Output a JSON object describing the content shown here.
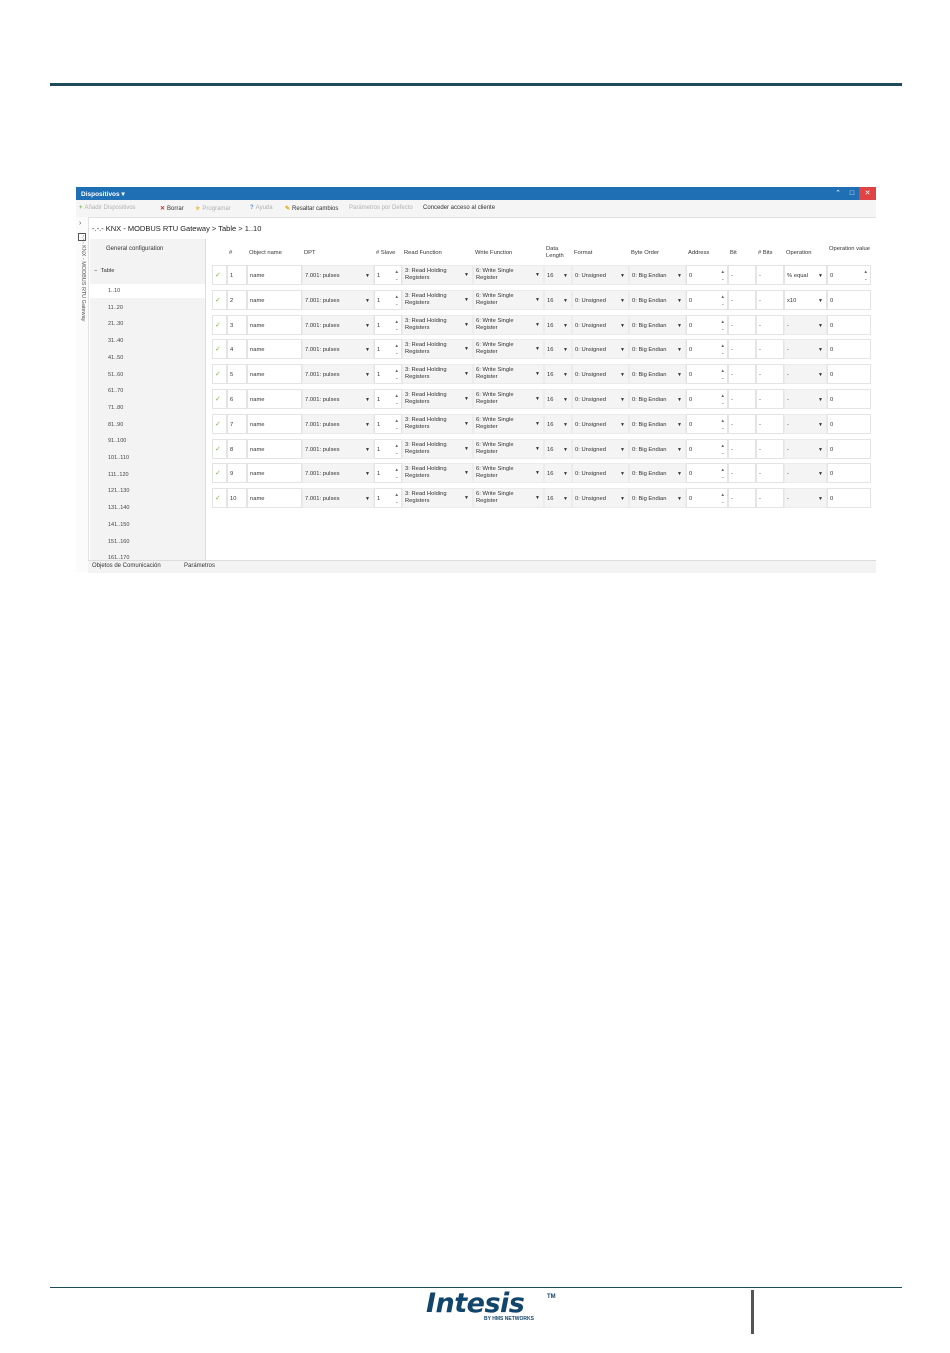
{
  "app": {
    "title": "Dispositivos ▾",
    "window_buttons": [
      "⌃",
      "□",
      "✕"
    ],
    "toolbar": [
      {
        "label": "Añadir Dispositivos",
        "icon": "+",
        "dim": true
      },
      {
        "label": "Borrar",
        "icon": "✕",
        "dim": false
      },
      {
        "label": "Programar",
        "icon": "★",
        "dim": true
      },
      {
        "label": "Ayuda",
        "icon": "?",
        "dim": true
      },
      {
        "label": "Resaltar cambios",
        "icon": "✎",
        "dim": false
      },
      {
        "label": "Parámetros por Defecto",
        "icon": "",
        "dim": true
      },
      {
        "label": "Conceder acceso al cliente",
        "icon": "",
        "dim": false
      }
    ],
    "side_strip_label": "-.-.- KNX - MODBUS RTU Gateway",
    "breadcrumb": {
      "prefix": "-.-.-",
      "path": "KNX - MODBUS RTU Gateway > Table > 1..10"
    },
    "tree": {
      "general": "General configuration",
      "table": "Table",
      "items": [
        "1..10",
        "11..20",
        "21..30",
        "31..40",
        "41..50",
        "51..60",
        "61..70",
        "71..80",
        "81..90",
        "91..100",
        "101..110",
        "111..120",
        "121..130",
        "131..140",
        "141..150",
        "151..160",
        "161..170"
      ],
      "selected": "1..10"
    },
    "columns": [
      "",
      "#",
      "Object name",
      "DPT",
      "# Slave",
      "Read Function",
      "Write Function",
      "Data Length",
      "Format",
      "Byte Order",
      "Address",
      "Bit",
      "# Bits",
      "Operation",
      "Operation value"
    ],
    "rows": [
      {
        "num": "1",
        "name": "name",
        "dpt": "7.001: pulses",
        "slave": "1",
        "read": "3: Read Holding Registers",
        "write": "6: Write Single Register",
        "length": "16",
        "format": "0: Unsigned",
        "order": "0: Big Endian",
        "address": "0",
        "bit": "-",
        "bits": "-",
        "op": "% equal",
        "opval": "0"
      },
      {
        "num": "2",
        "name": "name",
        "dpt": "7.001: pulses",
        "slave": "1",
        "read": "3: Read Holding Registers",
        "write": "6: Write Single Register",
        "length": "16",
        "format": "0: Unsigned",
        "order": "0: Big Endian",
        "address": "0",
        "bit": "-",
        "bits": "-",
        "op": "x10",
        "opval": "0"
      },
      {
        "num": "3",
        "name": "name",
        "dpt": "7.001: pulses",
        "slave": "1",
        "read": "3: Read Holding Registers",
        "write": "6: Write Single Register",
        "length": "16",
        "format": "0: Unsigned",
        "order": "0: Big Endian",
        "address": "0",
        "bit": "-",
        "bits": "-",
        "op": "-",
        "opval": "0"
      },
      {
        "num": "4",
        "name": "name",
        "dpt": "7.001: pulses",
        "slave": "1",
        "read": "3: Read Holding Registers",
        "write": "6: Write Single Register",
        "length": "16",
        "format": "0: Unsigned",
        "order": "0: Big Endian",
        "address": "0",
        "bit": "-",
        "bits": "-",
        "op": "-",
        "opval": "0"
      },
      {
        "num": "5",
        "name": "name",
        "dpt": "7.001: pulses",
        "slave": "1",
        "read": "3: Read Holding Registers",
        "write": "6: Write Single Register",
        "length": "16",
        "format": "0: Unsigned",
        "order": "0: Big Endian",
        "address": "0",
        "bit": "-",
        "bits": "-",
        "op": "-",
        "opval": "0"
      },
      {
        "num": "6",
        "name": "name",
        "dpt": "7.001: pulses",
        "slave": "1",
        "read": "3: Read Holding Registers",
        "write": "6: Write Single Register",
        "length": "16",
        "format": "0: Unsigned",
        "order": "0: Big Endian",
        "address": "0",
        "bit": "-",
        "bits": "-",
        "op": "-",
        "opval": "0"
      },
      {
        "num": "7",
        "name": "name",
        "dpt": "7.001: pulses",
        "slave": "1",
        "read": "3: Read Holding Registers",
        "write": "6: Write Single Register",
        "length": "16",
        "format": "0: Unsigned",
        "order": "0: Big Endian",
        "address": "0",
        "bit": "-",
        "bits": "-",
        "op": "-",
        "opval": "0"
      },
      {
        "num": "8",
        "name": "name",
        "dpt": "7.001: pulses",
        "slave": "1",
        "read": "3: Read Holding Registers",
        "write": "6: Write Single Register",
        "length": "16",
        "format": "0: Unsigned",
        "order": "0: Big Endian",
        "address": "0",
        "bit": "-",
        "bits": "-",
        "op": "-",
        "opval": "0"
      },
      {
        "num": "9",
        "name": "name",
        "dpt": "7.001: pulses",
        "slave": "1",
        "read": "3: Read Holding Registers",
        "write": "6: Write Single Register",
        "length": "16",
        "format": "0: Unsigned",
        "order": "0: Big Endian",
        "address": "0",
        "bit": "-",
        "bits": "-",
        "op": "-",
        "opval": "0"
      },
      {
        "num": "10",
        "name": "name",
        "dpt": "7.001: pulses",
        "slave": "1",
        "read": "3: Read Holding Registers",
        "write": "6: Write Single Register",
        "length": "16",
        "format": "0: Unsigned",
        "order": "0: Big Endian",
        "address": "0",
        "bit": "-",
        "bits": "-",
        "op": "-",
        "opval": "0"
      }
    ],
    "tabs": [
      "Objetos de Comunicación",
      "Parámetros"
    ]
  },
  "footer": {
    "logo": "Intesis",
    "logo_tm": "TM",
    "logo_sub": "BY HMS NETWORKS"
  },
  "colors": {
    "rule": "#1e4a5c",
    "titlebar": "#1f6fb5",
    "logo": "#12456b",
    "check": "#7fb34b"
  }
}
